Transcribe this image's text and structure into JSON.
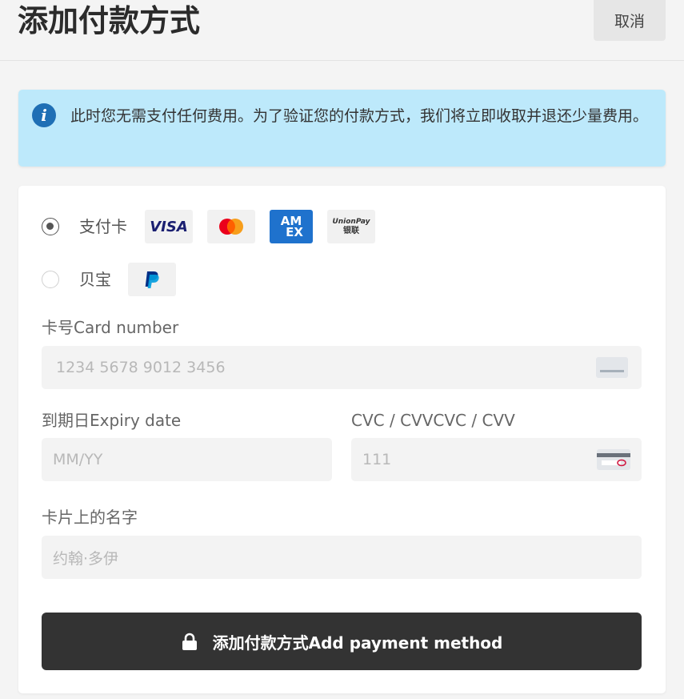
{
  "header": {
    "title": "添加付款方式",
    "cancel_label": "取消"
  },
  "info": {
    "text": "此时您无需支付任何费用。为了验证您的付款方式，我们将立即收取并退还少量费用。"
  },
  "methods": [
    {
      "label": "支付卡",
      "selected": true,
      "logos": [
        "visa-logo",
        "mastercard-logo",
        "amex-logo",
        "unionpay-logo"
      ]
    },
    {
      "label": "贝宝",
      "selected": false,
      "logos": [
        "paypal-logo"
      ]
    }
  ],
  "logos": {
    "visa": "VISA",
    "amex_top": "AM",
    "amex_bottom": "EX",
    "unionpay_top": "UnionPay",
    "unionpay_bottom": "银联"
  },
  "form": {
    "card_number_label": "卡号Card number",
    "card_number_placeholder": "1234 5678 9012 3456",
    "expiry_label": "到期日Expiry date",
    "expiry_placeholder": "MM/YY",
    "cvc_label": "CVC / CVVCVC / CVV",
    "cvc_placeholder": "111",
    "name_label": "卡片上的名字",
    "name_placeholder": "约翰·多伊"
  },
  "submit": {
    "label": "添加付款方式Add payment method"
  },
  "colors": {
    "info_bg": "#bde9fb",
    "info_icon": "#1f6fb5",
    "button_bg": "#333333",
    "amex_blue": "#1f72cd",
    "mastercard_red": "#eb001b",
    "mastercard_orange": "#f79e1b",
    "visa_blue": "#1a1f71",
    "paypal_blue": "#003087"
  }
}
